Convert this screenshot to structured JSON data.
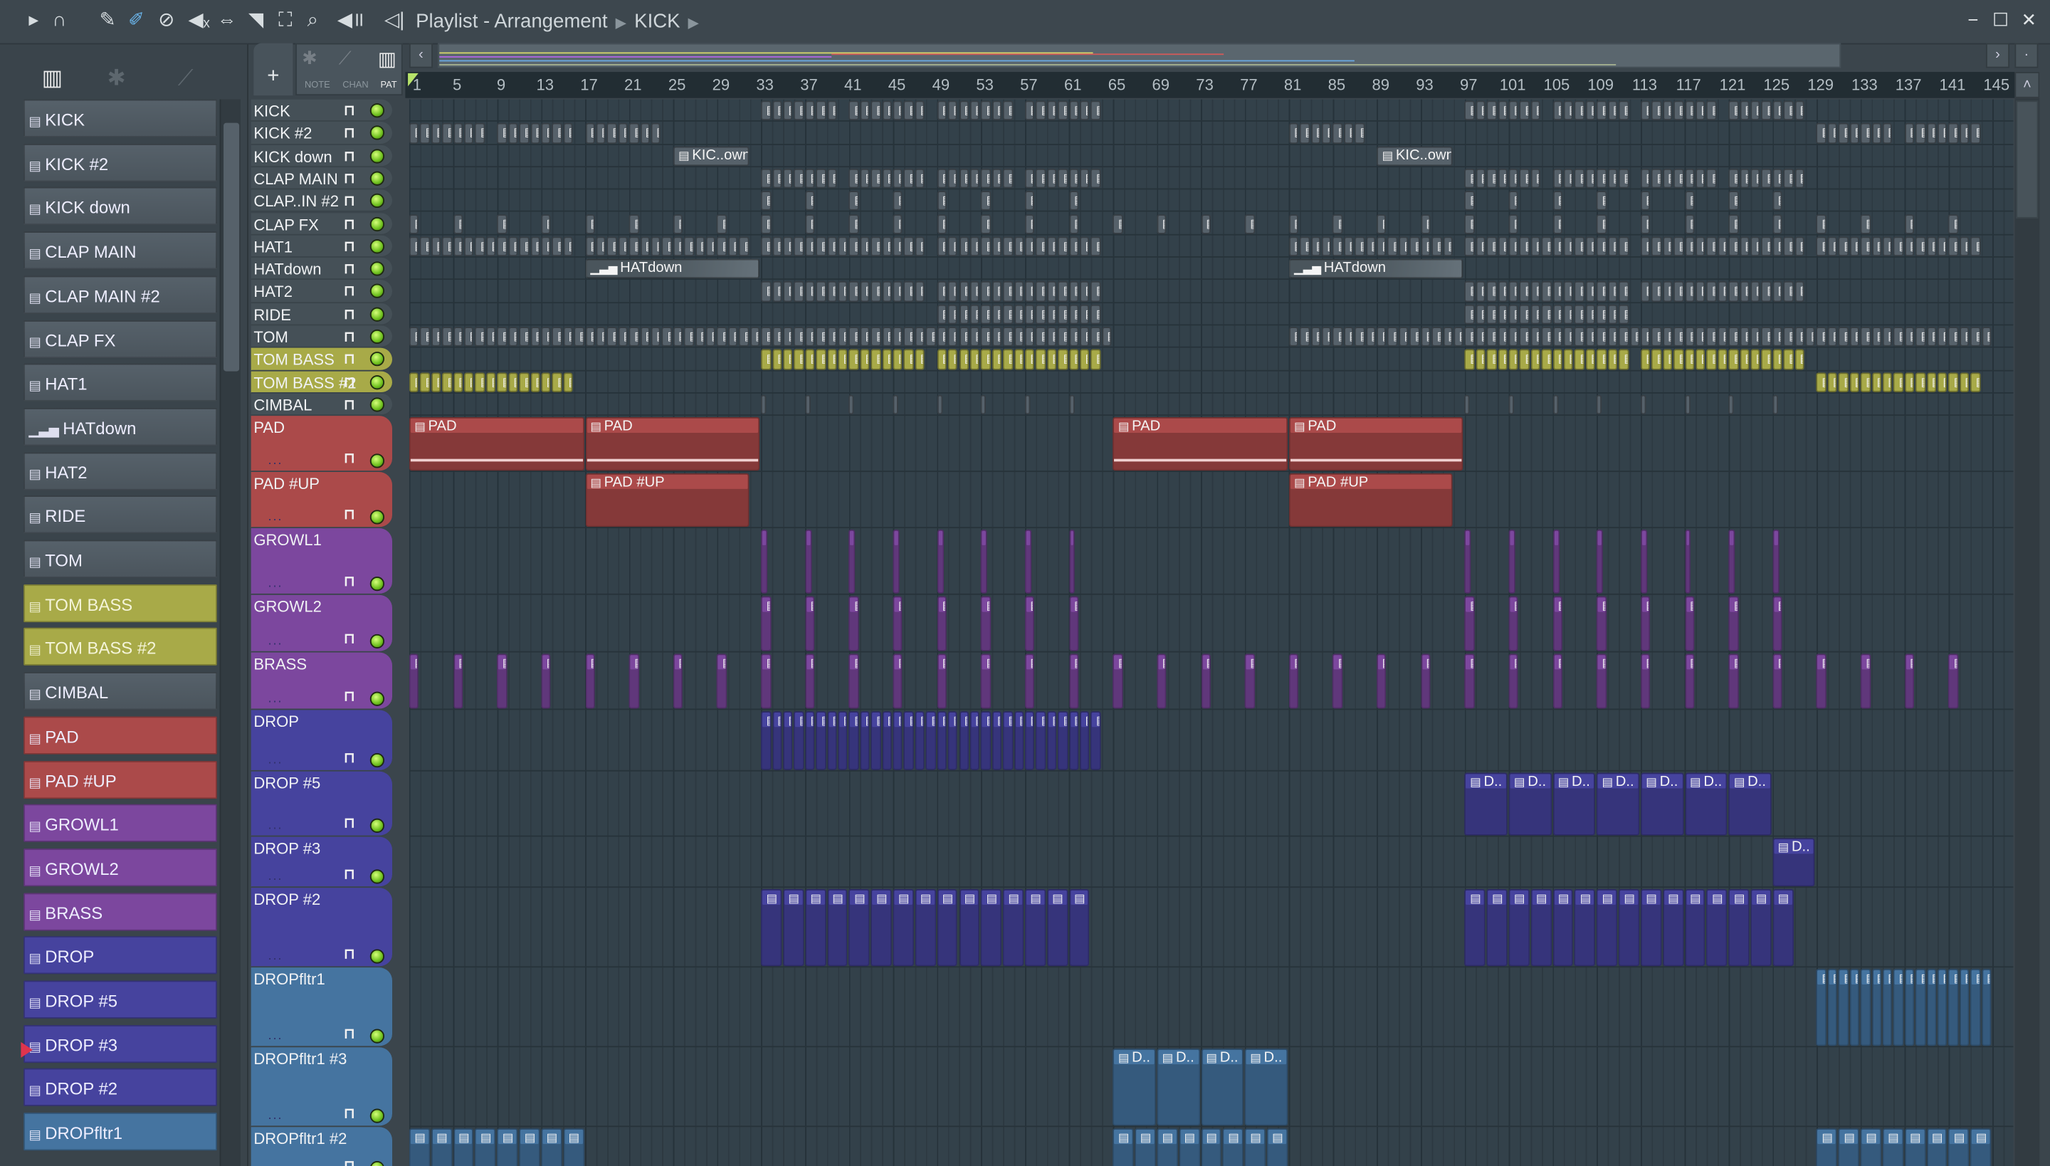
{
  "toolbar": {
    "title": "Playlist - Arrangement",
    "breadcrumb": "KICK",
    "icons": [
      "play-arrow",
      "magnet",
      "pencil",
      "paint",
      "delete",
      "mute",
      "slip",
      "slice",
      "select",
      "zoom",
      "playback"
    ],
    "window": {
      "minimize": "−",
      "maximize": "☐",
      "close": "✕"
    }
  },
  "mode": {
    "note": "NOTE",
    "chan": "CHAN",
    "pat": "PAT",
    "add": "+"
  },
  "ruler": {
    "labels": [
      "1",
      "5",
      "9",
      "13",
      "17",
      "21",
      "25",
      "29",
      "33",
      "37",
      "41",
      "45",
      "49",
      "53",
      "57",
      "61",
      "65",
      "69",
      "73",
      "77",
      "81",
      "85",
      "89",
      "93",
      "97",
      "101",
      "105",
      "109",
      "113",
      "117",
      "121",
      "125",
      "129",
      "133",
      "137",
      "141",
      "145"
    ]
  },
  "colors": {
    "grey": "#5a656d",
    "olive": "#a8aa48",
    "red": "#ab4a4a",
    "purple": "#7c479e",
    "indigo": "#46439e",
    "steel": "#4574a0",
    "accent": "#e0344e"
  },
  "patterns": [
    {
      "name": "KICK",
      "color": "grey",
      "icon": "▤"
    },
    {
      "name": "KICK #2",
      "color": "grey",
      "icon": "▤"
    },
    {
      "name": "KICK down",
      "color": "grey",
      "icon": "▤"
    },
    {
      "name": "CLAP MAIN",
      "color": "grey",
      "icon": "▤"
    },
    {
      "name": "CLAP MAIN #2",
      "color": "grey",
      "icon": "▤"
    },
    {
      "name": "CLAP FX",
      "color": "grey",
      "icon": "▤"
    },
    {
      "name": "HAT1",
      "color": "grey",
      "icon": "▤"
    },
    {
      "name": "HATdown",
      "color": "grey",
      "icon": "▁▃▅"
    },
    {
      "name": "HAT2",
      "color": "grey",
      "icon": "▤"
    },
    {
      "name": "RIDE",
      "color": "grey",
      "icon": "▤"
    },
    {
      "name": "TOM",
      "color": "grey",
      "icon": "▤"
    },
    {
      "name": "TOM BASS",
      "color": "olive",
      "icon": "▤"
    },
    {
      "name": "TOM BASS #2",
      "color": "olive",
      "icon": "▤"
    },
    {
      "name": "CIMBAL",
      "color": "grey",
      "icon": "▤"
    },
    {
      "name": "PAD",
      "color": "red",
      "icon": "▤"
    },
    {
      "name": "PAD #UP",
      "color": "red",
      "icon": "▤"
    },
    {
      "name": "GROWL1",
      "color": "purple",
      "icon": "▤"
    },
    {
      "name": "GROWL2",
      "color": "purple",
      "icon": "▤"
    },
    {
      "name": "BRASS",
      "color": "purple",
      "icon": "▤"
    },
    {
      "name": "DROP",
      "color": "indigo",
      "icon": "▤"
    },
    {
      "name": "DROP #5",
      "color": "indigo",
      "icon": "▤"
    },
    {
      "name": "DROP #3",
      "color": "indigo",
      "icon": "▤"
    },
    {
      "name": "DROP #2",
      "color": "indigo",
      "icon": "▤"
    },
    {
      "name": "DROPfltr1",
      "color": "steel",
      "icon": "▤"
    }
  ],
  "tracks": [
    {
      "name": "KICK",
      "color": "grey",
      "clips": [
        {
          "start": 33,
          "count": 7,
          "len": 1
        },
        {
          "start": 41,
          "count": 7,
          "len": 1
        },
        {
          "start": 49,
          "count": 7,
          "len": 1
        },
        {
          "start": 57,
          "count": 7,
          "len": 1
        },
        {
          "start": 97,
          "count": 7,
          "len": 1
        },
        {
          "start": 105,
          "count": 7,
          "len": 1
        },
        {
          "start": 113,
          "count": 7,
          "len": 1
        },
        {
          "start": 121,
          "count": 7,
          "len": 1
        }
      ]
    },
    {
      "name": "KICK #2",
      "color": "grey",
      "clips": [
        {
          "start": 1,
          "count": 7,
          "len": 1
        },
        {
          "start": 9,
          "count": 7,
          "len": 1
        },
        {
          "start": 17,
          "count": 7,
          "len": 1
        },
        {
          "start": 81,
          "count": 7,
          "len": 1
        },
        {
          "start": 129,
          "count": 7,
          "len": 1
        },
        {
          "start": 137,
          "count": 7,
          "len": 1
        }
      ]
    },
    {
      "name": "KICK down",
      "color": "grey",
      "clips": [
        {
          "start": 25,
          "count": 1,
          "len": 7,
          "label": "KIC..own"
        },
        {
          "start": 89,
          "count": 1,
          "len": 7,
          "label": "KIC..own"
        }
      ]
    },
    {
      "name": "CLAP MAIN",
      "color": "grey",
      "clips": [
        {
          "start": 33,
          "count": 7,
          "len": 1
        },
        {
          "start": 41,
          "count": 7,
          "len": 1
        },
        {
          "start": 49,
          "count": 7,
          "len": 1
        },
        {
          "start": 57,
          "count": 7,
          "len": 1
        },
        {
          "start": 97,
          "count": 7,
          "len": 1
        },
        {
          "start": 105,
          "count": 7,
          "len": 1
        },
        {
          "start": 113,
          "count": 7,
          "len": 1
        },
        {
          "start": 121,
          "count": 7,
          "len": 1
        }
      ]
    },
    {
      "name": "CLAP..IN #2",
      "color": "grey",
      "clips": [
        {
          "start": 33,
          "count": 8,
          "step": 4,
          "len": 1
        },
        {
          "start": 97,
          "count": 8,
          "step": 4,
          "len": 1
        }
      ]
    },
    {
      "name": "CLAP FX",
      "color": "grey",
      "clips": [
        {
          "start": 1,
          "count": 36,
          "step": 4,
          "len": 1
        }
      ]
    },
    {
      "name": "HAT1",
      "color": "grey",
      "clips": [
        {
          "start": 1,
          "count": 15,
          "len": 1
        },
        {
          "start": 17,
          "count": 15,
          "len": 1
        },
        {
          "start": 33,
          "count": 15,
          "len": 1
        },
        {
          "start": 49,
          "count": 15,
          "len": 1
        },
        {
          "start": 81,
          "count": 15,
          "len": 1
        },
        {
          "start": 97,
          "count": 15,
          "len": 1
        },
        {
          "start": 113,
          "count": 15,
          "len": 1
        },
        {
          "start": 129,
          "count": 15,
          "len": 1
        }
      ]
    },
    {
      "name": "HATdown",
      "color": "grey",
      "clips": [
        {
          "start": 17,
          "count": 1,
          "len": 16,
          "label": "HATdown",
          "auto": true
        },
        {
          "start": 81,
          "count": 1,
          "len": 16,
          "label": "HATdown",
          "auto": true
        }
      ]
    },
    {
      "name": "HAT2",
      "color": "grey",
      "clips": [
        {
          "start": 33,
          "count": 15,
          "len": 1
        },
        {
          "start": 49,
          "count": 15,
          "len": 1
        },
        {
          "start": 97,
          "count": 15,
          "len": 1
        },
        {
          "start": 113,
          "count": 15,
          "len": 1
        }
      ]
    },
    {
      "name": "RIDE",
      "color": "grey",
      "clips": [
        {
          "start": 49,
          "count": 15,
          "len": 1
        },
        {
          "start": 97,
          "count": 15,
          "len": 1
        }
      ]
    },
    {
      "name": "TOM",
      "color": "grey",
      "clips": [
        {
          "start": 1,
          "count": 64,
          "len": 1
        },
        {
          "start": 81,
          "count": 64,
          "len": 1
        }
      ]
    },
    {
      "name": "TOM BASS",
      "color": "olive",
      "clips": [
        {
          "start": 33,
          "count": 15,
          "len": 1
        },
        {
          "start": 49,
          "count": 15,
          "len": 1
        },
        {
          "start": 97,
          "count": 15,
          "len": 1
        },
        {
          "start": 113,
          "count": 15,
          "len": 1
        }
      ]
    },
    {
      "name": "TOM BASS #2",
      "color": "olive",
      "clips": [
        {
          "start": 1,
          "count": 15,
          "len": 1
        },
        {
          "start": 129,
          "count": 15,
          "len": 1
        }
      ]
    },
    {
      "name": "CIMBAL",
      "color": "grey",
      "clips": [
        {
          "start": 33,
          "count": 8,
          "step": 4,
          "len": 0.6
        },
        {
          "start": 97,
          "count": 8,
          "step": 4,
          "len": 0.6
        }
      ]
    },
    {
      "name": "PAD",
      "color": "red",
      "clips": [
        {
          "start": 1,
          "count": 1,
          "len": 16,
          "label": "PAD"
        },
        {
          "start": 17,
          "count": 1,
          "len": 16,
          "label": "PAD"
        },
        {
          "start": 65,
          "count": 1,
          "len": 16,
          "label": "PAD"
        },
        {
          "start": 81,
          "count": 1,
          "len": 16,
          "label": "PAD"
        }
      ]
    },
    {
      "name": "PAD #UP",
      "color": "red",
      "clips": [
        {
          "start": 17,
          "count": 1,
          "len": 15,
          "label": "PAD #UP"
        },
        {
          "start": 81,
          "count": 1,
          "len": 15,
          "label": "PAD #UP"
        }
      ]
    },
    {
      "name": "GROWL1",
      "color": "purple",
      "clips": [
        {
          "start": 33,
          "count": 8,
          "step": 4,
          "len": 0.7
        },
        {
          "start": 97,
          "count": 8,
          "step": 4,
          "len": 0.7
        }
      ]
    },
    {
      "name": "GROWL2",
      "color": "purple",
      "clips": [
        {
          "start": 33,
          "count": 8,
          "step": 4,
          "len": 1
        },
        {
          "start": 97,
          "count": 8,
          "step": 4,
          "len": 1
        }
      ]
    },
    {
      "name": "BRASS",
      "color": "purple",
      "clips": [
        {
          "start": 1,
          "count": 36,
          "step": 4,
          "len": 1
        }
      ]
    },
    {
      "name": "DROP",
      "color": "indigo",
      "clips": [
        {
          "start": 33,
          "count": 31,
          "len": 1
        }
      ]
    },
    {
      "name": "DROP #5",
      "color": "indigo",
      "clips": [
        {
          "start": 97,
          "count": 7,
          "step": 4,
          "len": 4,
          "label": "D.."
        }
      ]
    },
    {
      "name": "DROP #3",
      "color": "indigo",
      "clips": [
        {
          "start": 125,
          "count": 1,
          "len": 4,
          "label": "D.."
        }
      ]
    },
    {
      "name": "DROP #2",
      "color": "indigo",
      "clips": [
        {
          "start": 33,
          "count": 15,
          "step": 2,
          "len": 2
        },
        {
          "start": 97,
          "count": 15,
          "step": 2,
          "len": 2
        }
      ]
    },
    {
      "name": "DROPfltr1",
      "color": "steel",
      "clips": [
        {
          "start": 129,
          "count": 16,
          "len": 1
        }
      ]
    },
    {
      "name": "DROPfltr1 #3",
      "color": "steel",
      "clips": [
        {
          "start": 65,
          "count": 4,
          "step": 4,
          "len": 4,
          "label": "D.."
        }
      ]
    },
    {
      "name": "DROPfltr1 #2",
      "color": "steel",
      "clips": [
        {
          "start": 1,
          "count": 8,
          "step": 2,
          "len": 2
        },
        {
          "start": 65,
          "count": 8,
          "step": 2,
          "len": 2
        },
        {
          "start": 129,
          "count": 8,
          "step": 2,
          "len": 2
        }
      ]
    }
  ],
  "track_header": {
    "dots": "...",
    "lock": "🔒"
  }
}
